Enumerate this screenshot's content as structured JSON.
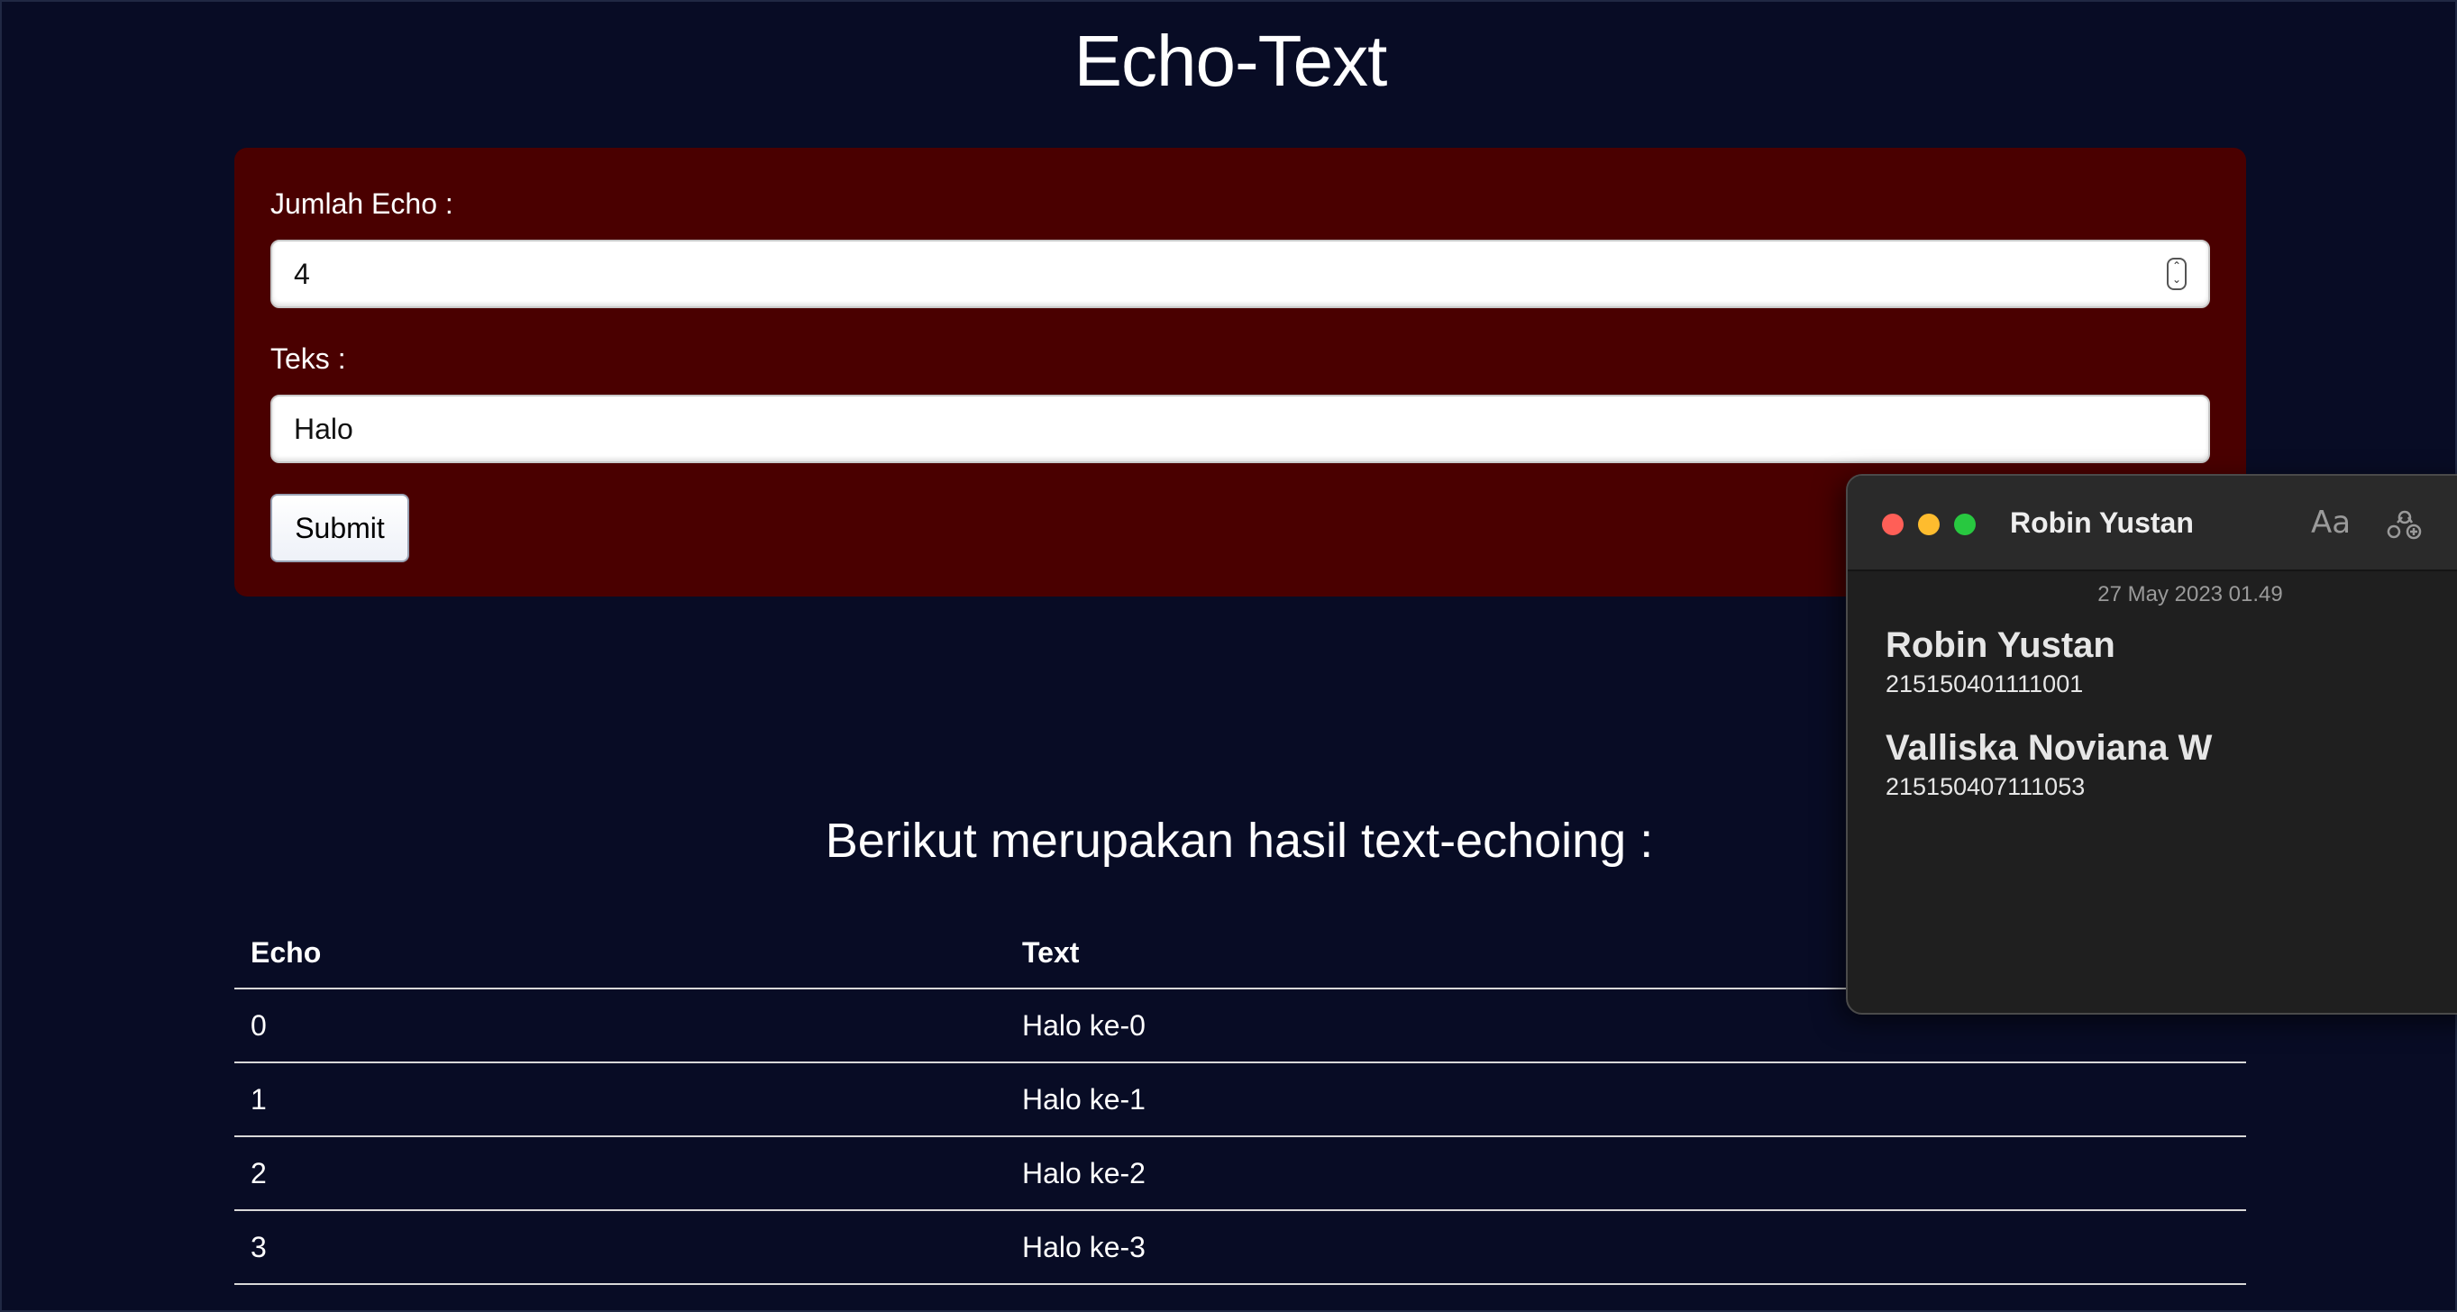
{
  "page": {
    "title": "Echo-Text"
  },
  "form": {
    "count_label": "Jumlah Echo :",
    "count_value": "4",
    "text_label": "Teks :",
    "text_value": "Halo",
    "submit_label": "Submit"
  },
  "results": {
    "heading": "Berikut merupakan hasil text-echoing :",
    "columns": [
      "Echo",
      "Text"
    ],
    "rows": [
      {
        "echo": "0",
        "text": "Halo ke-0"
      },
      {
        "echo": "1",
        "text": "Halo ke-1"
      },
      {
        "echo": "2",
        "text": "Halo ke-2"
      },
      {
        "echo": "3",
        "text": "Halo ke-3"
      }
    ]
  },
  "notes": {
    "window_title": "Robin Yustan",
    "font_button": "Aa",
    "date": "27 May 2023 01.49",
    "people": [
      {
        "name": "Robin Yustan",
        "id": "215150401111001"
      },
      {
        "name": "Valliska Noviana W",
        "id": "215150407111053"
      }
    ],
    "icons": {
      "close": "close-icon",
      "minimize": "minimize-icon",
      "maximize": "maximize-icon",
      "share": "collaborate-icon"
    },
    "colors": {
      "close": "#ff5f57",
      "minimize": "#febc2e",
      "maximize": "#28c840"
    }
  },
  "colors": {
    "background": "#080c25",
    "form_card": "#4a0000"
  }
}
